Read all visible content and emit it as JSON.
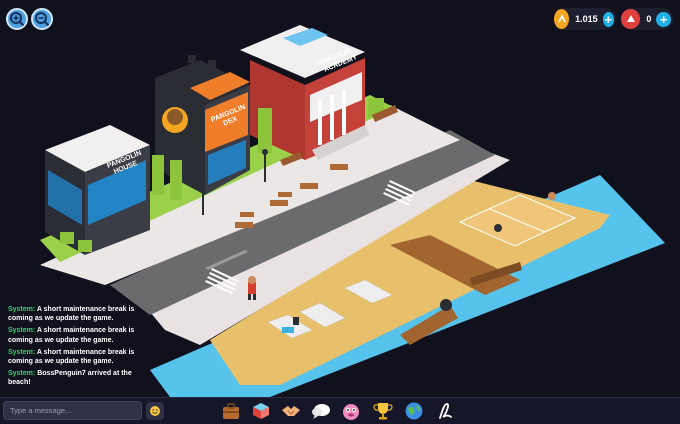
{
  "hud": {
    "coins": "1.015",
    "gems": "0",
    "coin_color": "#f5a623",
    "gem_color": "#e0413f",
    "plus_color": "#22b0e8"
  },
  "buildings": {
    "house_sign": "PANGOLIN HOUSE",
    "dex_sign": "PANGOLIN DEX",
    "academy_sign": "PANGOLIN ACADEMY"
  },
  "chat": {
    "messages": [
      {
        "sender": "System:",
        "text": "A short maintenance break is coming as we update the game."
      },
      {
        "sender": "System:",
        "text": "A short maintenance break is coming as we update the game."
      },
      {
        "sender": "System:",
        "text": "A short maintenance break is coming as we update the game."
      },
      {
        "sender": "System:",
        "text": "BossPenguin7 arrived at the beach!"
      }
    ],
    "input_placeholder": "Type a message..."
  },
  "toolbar": {
    "icons": [
      "briefcase-icon",
      "inventory-box-icon",
      "handshake-icon",
      "chat-bubble-icon",
      "pet-icon",
      "trophy-icon",
      "globe-icon",
      "signature-icon"
    ]
  },
  "zoom": {
    "in_icon": "zoom-in-icon",
    "out_icon": "zoom-out-icon"
  }
}
